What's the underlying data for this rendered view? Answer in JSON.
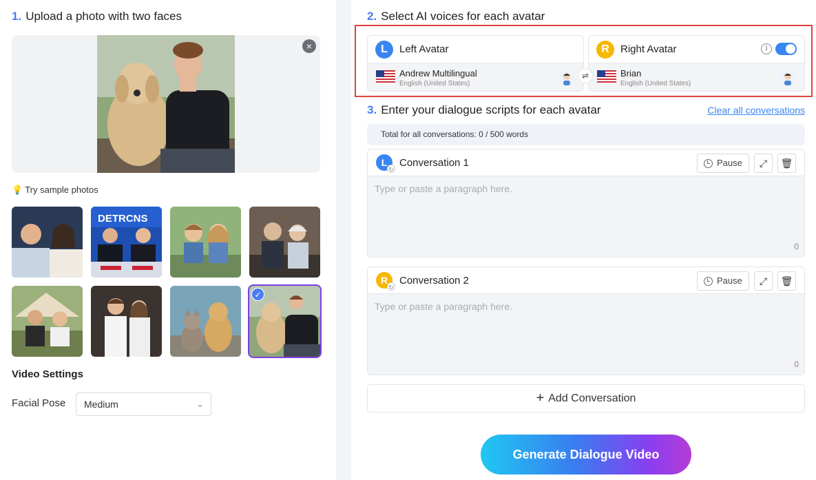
{
  "step1": {
    "num": "1.",
    "label": "Upload a photo with two faces"
  },
  "upload": {
    "close": "×"
  },
  "samples": {
    "label": "Try sample photos",
    "items": [
      {
        "alt": "two news anchors"
      },
      {
        "alt": "news studio"
      },
      {
        "alt": "two kids"
      },
      {
        "alt": "elderly couple"
      },
      {
        "alt": "couple at tent"
      },
      {
        "alt": "young couple"
      },
      {
        "alt": "cat and dog"
      },
      {
        "alt": "man with dog",
        "selected": true
      }
    ]
  },
  "video_settings": {
    "title": "Video Settings",
    "facial_pose_label": "Facial Pose",
    "facial_pose_value": "Medium"
  },
  "step2": {
    "num": "2.",
    "label": "Select AI voices for each avatar"
  },
  "voices": {
    "left": {
      "badge": "L",
      "title": "Left Avatar",
      "voice": "Andrew Multilingual",
      "lang": "English (United States)"
    },
    "right": {
      "badge": "R",
      "title": "Right Avatar",
      "voice": "Brian",
      "lang": "English (United States)"
    },
    "swap": "⇌",
    "info": "i"
  },
  "step3": {
    "num": "3.",
    "label": "Enter your dialogue scripts for each avatar"
  },
  "clear_all": "Clear all conversations",
  "total": "Total for all conversations: 0 / 500 words",
  "conversations": [
    {
      "badge": "L",
      "title": "Conversation 1",
      "pause": "Pause",
      "placeholder": "Type or paste a paragraph here.",
      "count": "0"
    },
    {
      "badge": "R",
      "title": "Conversation 2",
      "pause": "Pause",
      "placeholder": "Type or paste a paragraph here.",
      "count": "0"
    }
  ],
  "add_conversation": {
    "plus": "+",
    "label": "Add Conversation"
  },
  "generate": "Generate Dialogue Video",
  "colors": {
    "accent": "#3a86f0",
    "left_badge": "#3a86f0",
    "right_badge": "#f6b800",
    "highlight": "#e0413a"
  }
}
